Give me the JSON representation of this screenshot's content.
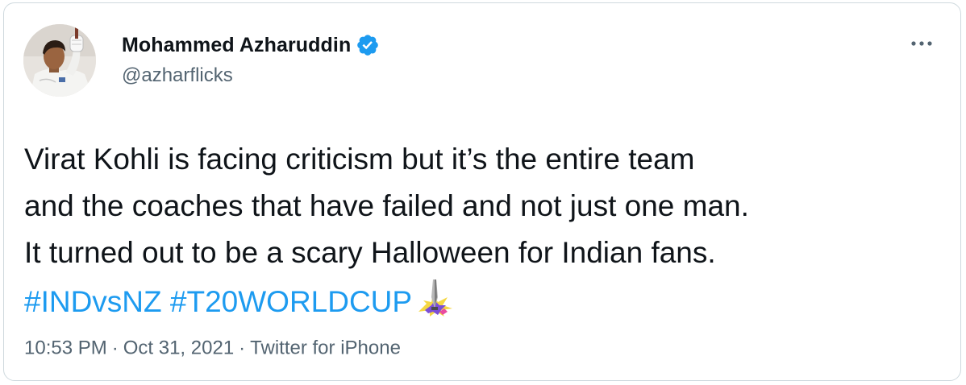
{
  "author": {
    "display_name": "Mohammed Azharuddin",
    "handle": "@azharflicks",
    "verified": true
  },
  "tweet": {
    "lines": [
      "Virat Kohli is facing criticism but it’s the entire team",
      "and the coaches that have failed and not just one man.",
      "It turned out to be a scary Halloween for Indian fans."
    ],
    "hashtags": [
      "#INDvsNZ",
      "#T20WORLDCUP"
    ],
    "emoji": "t20-world-cup-trophy-icon"
  },
  "meta": {
    "time": "10:53 PM",
    "date": "Oct 31, 2021",
    "source": "Twitter for iPhone",
    "separator": "·"
  },
  "colors": {
    "text": "#0f1419",
    "secondary": "#536471",
    "link": "#1d9bf0",
    "border": "#cfd9de"
  }
}
